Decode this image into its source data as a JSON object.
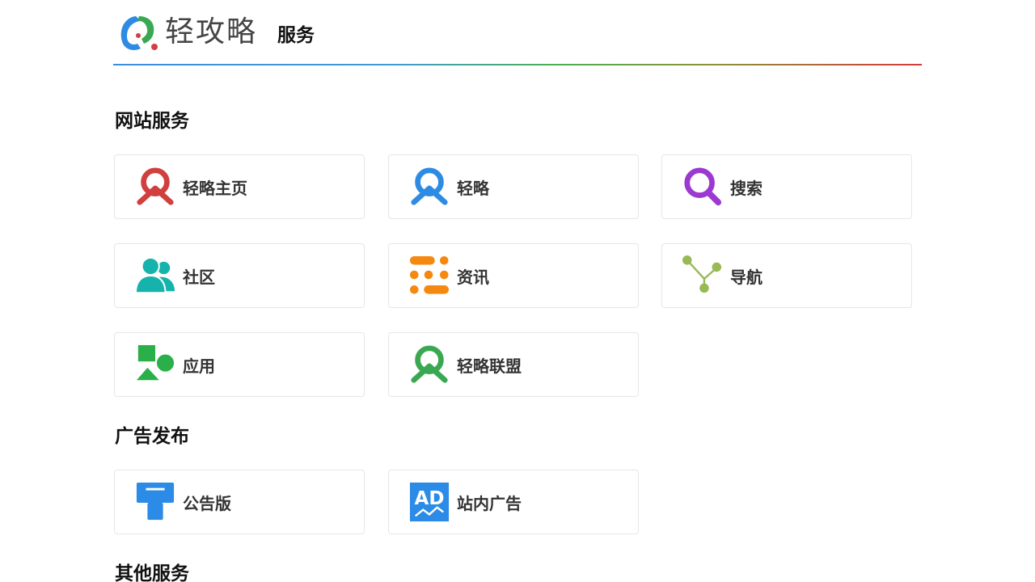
{
  "header": {
    "logo_text": "轻攻略",
    "page_title": "服务"
  },
  "sections": [
    {
      "title": "网站服务",
      "items": [
        {
          "label": "轻略主页",
          "icon": "qinglue-red-icon",
          "color": "#d0403f"
        },
        {
          "label": "轻略",
          "icon": "qinglue-blue-icon",
          "color": "#2d8be3"
        },
        {
          "label": "搜索",
          "icon": "search-icon",
          "color": "#9b39d1"
        },
        {
          "label": "社区",
          "icon": "users-icon",
          "color": "#16b3ad"
        },
        {
          "label": "资讯",
          "icon": "news-icon",
          "color": "#f5890f"
        },
        {
          "label": "导航",
          "icon": "navigation-icon",
          "color": "#98b957"
        },
        {
          "label": "应用",
          "icon": "apps-icon",
          "color": "#2aaf4a"
        },
        {
          "label": "轻略联盟",
          "icon": "qinglue-green-icon",
          "color": "#3aa853"
        }
      ]
    },
    {
      "title": "广告发布",
      "items": [
        {
          "label": "公告版",
          "icon": "bulletin-board-icon",
          "color": "#2b8be6"
        },
        {
          "label": "站内广告",
          "icon": "ad-icon",
          "color": "#2b8be6"
        }
      ]
    },
    {
      "title": "其他服务",
      "items": []
    }
  ]
}
